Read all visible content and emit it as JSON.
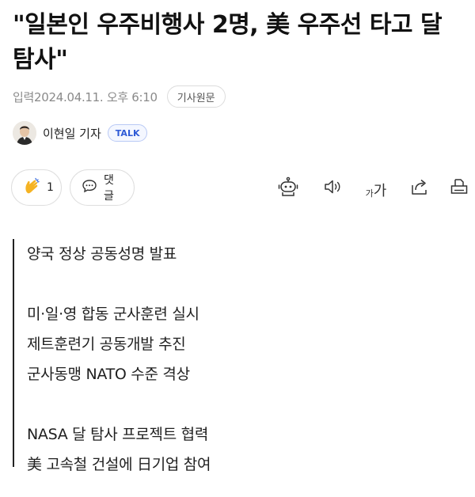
{
  "article": {
    "headline": "\"일본인 우주비행사 2명, 美 우주선 타고 달 탐사\"",
    "date_label": "입력",
    "date_value": "2024.04.11. 오후 6:10",
    "origin_button": "기사원문",
    "reporter": "이현일 기자",
    "talk_badge": "TALK"
  },
  "actions": {
    "like_count": "1",
    "comment_label": "댓글",
    "font_small": "가",
    "font_big": "가"
  },
  "quote": {
    "lines": [
      "양국 정상 공동성명 발표",
      "",
      "미·일·영 합동 군사훈련 실시",
      "제트훈련기 공동개발 추진",
      "군사동맹 NATO 수준 격상",
      "",
      "NASA 달 탐사 프로젝트 협력",
      "美 고속철 건설에 日기업 참여"
    ]
  },
  "icons": {
    "like": "clap-hand-icon",
    "comment": "speech-bubble-icon",
    "summary": "robot-icon",
    "tts": "speaker-icon",
    "font": "font-size-icon",
    "share": "share-icon",
    "print": "print-icon"
  },
  "colors": {
    "talk_badge": "#2f5bd6",
    "like_icon": "#f5b323",
    "quote_bar": "#222222"
  }
}
